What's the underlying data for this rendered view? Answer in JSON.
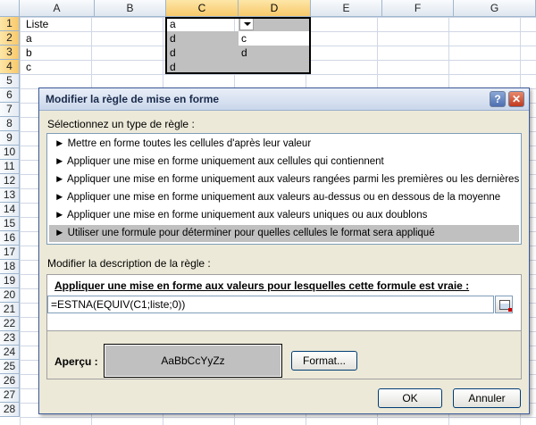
{
  "spreadsheet": {
    "columns": [
      "A",
      "B",
      "C",
      "D",
      "E",
      "F",
      "G"
    ],
    "rows": [
      "1",
      "2",
      "3",
      "4",
      "5",
      "6",
      "7",
      "8",
      "9",
      "10",
      "11",
      "12",
      "13",
      "14",
      "15",
      "16",
      "17",
      "18",
      "19",
      "20",
      "21",
      "22",
      "23",
      "24",
      "25",
      "26",
      "27",
      "28"
    ],
    "cells": {
      "A1": "Liste",
      "A2": "a",
      "A3": "b",
      "A4": "c",
      "C1": "a",
      "C2": "d",
      "C3": "d",
      "C4": "d",
      "D2": "c",
      "D3": "d"
    }
  },
  "dialog": {
    "title": "Modifier la règle de mise en forme",
    "help_label": "?",
    "close_label": "✕",
    "rule_type_label": "Sélectionnez un type de règle :",
    "rule_types": [
      "► Mettre en forme toutes les cellules d'après leur valeur",
      "► Appliquer une mise en forme uniquement aux cellules qui contiennent",
      "► Appliquer une mise en forme uniquement aux valeurs rangées parmi les premières ou les dernières valeurs",
      "► Appliquer une mise en forme uniquement aux valeurs au-dessus ou en dessous de la moyenne",
      "► Appliquer une mise en forme uniquement aux valeurs uniques ou aux doublons",
      "► Utiliser une formule pour déterminer pour quelles cellules le format sera appliqué"
    ],
    "selected_rule_index": 5,
    "description_label": "Modifier la description de la règle :",
    "formula_heading": "Appliquer une mise en forme aux valeurs pour lesquelles cette formule est vraie :",
    "formula_value": "=ESTNA(EQUIV(C1;liste;0))",
    "preview_label": "Aperçu :",
    "preview_text": "AaBbCcYyZz",
    "format_button": "Format...",
    "ok_button": "OK",
    "cancel_button": "Annuler"
  },
  "colors": {
    "highlight_grey": "#c0c0c0",
    "selected_header": "#f8c96a",
    "dialog_bg": "#ece9d8"
  }
}
